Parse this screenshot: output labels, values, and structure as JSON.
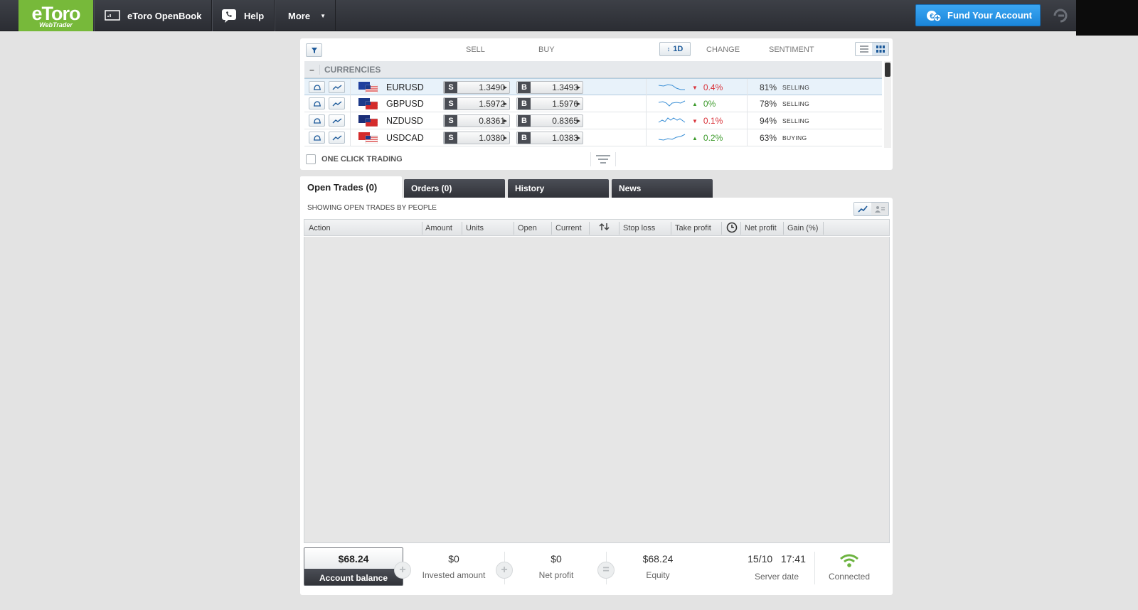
{
  "topbar": {
    "logo_name": "eToro",
    "logo_sub": "WebTrader",
    "openbook_label": "eToro OpenBook",
    "help_label": "Help",
    "more_label": "More",
    "fund_label": "Fund Your Account",
    "brand_color": "#77b93a",
    "fund_color": "#2a97e8"
  },
  "instruments": {
    "sell_header": "SELL",
    "buy_header": "BUY",
    "period": "1D",
    "change_header": "CHANGE",
    "sentiment_header": "SENTIMENT",
    "category": "CURRENCIES",
    "sell_tag": "S",
    "buy_tag": "B",
    "rows": [
      {
        "symbol": "EURUSD",
        "sell": "1.3490",
        "buy": "1.3493",
        "change": "0.4%",
        "direction": "down",
        "sentiment": "81%",
        "sentiment_label": "SELLING"
      },
      {
        "symbol": "GBPUSD",
        "sell": "1.5972",
        "buy": "1.5976",
        "change": "0%",
        "direction": "up",
        "sentiment": "78%",
        "sentiment_label": "SELLING"
      },
      {
        "symbol": "NZDUSD",
        "sell": "0.8361",
        "buy": "0.8365",
        "change": "0.1%",
        "direction": "down",
        "sentiment": "94%",
        "sentiment_label": "SELLING"
      },
      {
        "symbol": "USDCAD",
        "sell": "1.0380",
        "buy": "1.0383",
        "change": "0.2%",
        "direction": "up",
        "sentiment": "63%",
        "sentiment_label": "BUYING"
      }
    ],
    "one_click_label": "ONE CLICK TRADING"
  },
  "tabs": [
    {
      "label": "Open Trades (0)"
    },
    {
      "label": "Orders (0)"
    },
    {
      "label": "History"
    },
    {
      "label": "News"
    }
  ],
  "trades": {
    "showing_label": "SHOWING OPEN TRADES BY PEOPLE",
    "columns": [
      "Action",
      "Amount",
      "Units",
      "Open",
      "Current",
      "Stop loss",
      "Take profit",
      "Net profit",
      "Gain (%)"
    ]
  },
  "footer": {
    "balance_value": "$68.24",
    "balance_label": "Account balance",
    "invested_value": "$0",
    "invested_label": "Invested amount",
    "netprofit_value": "$0",
    "netprofit_label": "Net profit",
    "equity_value": "$68.24",
    "equity_label": "Equity",
    "server_date": "15/10",
    "server_time": "17:41",
    "server_label": "Server date",
    "connection_label": "Connected",
    "plus_symbol": "+",
    "equals_symbol": "="
  }
}
